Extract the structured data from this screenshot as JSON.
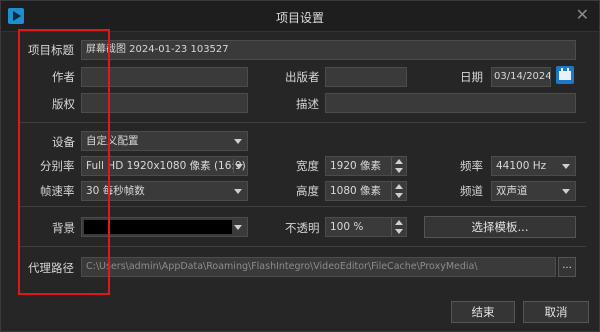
{
  "window": {
    "title": "项目设置",
    "close_glyph": "✕"
  },
  "labels": {
    "project_title": "项目标题",
    "author": "作者",
    "publisher": "出版者",
    "date": "日期",
    "copyright": "版权",
    "description": "描述",
    "device": "设备",
    "resolution": "分别率",
    "width": "宽度",
    "frequency": "频率",
    "frame_rate": "帧速率",
    "height": "高度",
    "channel": "频道",
    "background": "背景",
    "opacity": "不透明",
    "proxy_path": "代理路径"
  },
  "values": {
    "project_title": "屏幕截图 2024-01-23 103527",
    "author": "",
    "publisher": "",
    "date": "03/14/2024",
    "copyright": "",
    "description": "",
    "device": "自定义配置",
    "resolution": "Full HD 1920x1080 像素 (16:9)",
    "width": "1920 像素",
    "frequency": "44100 Hz",
    "frame_rate": "30 每秒帧数",
    "height": "1080 像素",
    "channel": "双声道",
    "background_color": "#000000",
    "opacity": "100 %",
    "proxy_path": "C:\\Users\\admin\\AppData\\Roaming\\FlashIntegro\\VideoEditor\\FileCache\\ProxyMedia\\"
  },
  "buttons": {
    "choose_template": "选择模板...",
    "browse": "...",
    "ok": "结束",
    "cancel": "取消"
  },
  "colors": {
    "highlight": "#e01818",
    "calendar_accent": "#1e78c8",
    "app_icon": "#1d8fd1"
  },
  "icons": {
    "app": "app-logo-icon",
    "calendar": "calendar-icon",
    "close": "close-icon"
  }
}
